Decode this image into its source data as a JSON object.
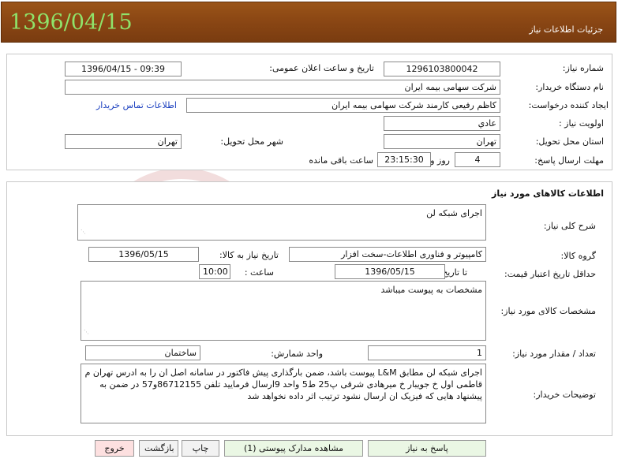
{
  "header": {
    "date": "1396/04/15",
    "title": "جزئیات اطلاعات نیاز"
  },
  "need": {
    "number_label": "شماره نیاز:",
    "number_value": "1296103800042",
    "announce_label": "تاریخ و ساعت اعلان عمومی:",
    "announce_value": "1396/04/15 - 09:39",
    "buyer_label": "نام دستگاه خریدار:",
    "buyer_value": "شرکت سهامی بیمه ایران",
    "creator_label": "ایجاد کننده درخواست:",
    "creator_value": "کاظم رفیعی کارمند شرکت سهامی بیمه ایران",
    "contact_link": "اطلاعات تماس خریدار",
    "priority_label": "اولویت نیاز :",
    "priority_value": "عادي",
    "province_label": "استان محل تحویل:",
    "province_value": "تهران",
    "city_label": "شهر محل تحویل:",
    "city_value": "تهران",
    "deadline_label": "مهلت ارسال پاسخ:",
    "deadline_days": "4",
    "days_label": "روز و",
    "deadline_time": "23:15:30",
    "remaining_label": "ساعت باقی مانده"
  },
  "goods": {
    "section_title": "اطلاعات کالاهای مورد نیاز",
    "desc_label": "شرح کلی نیاز:",
    "desc_value": "اجرای شبکه لن",
    "group_label": "گروه کالا:",
    "group_value": "کامپیوتر و فناوری اطلاعات-سخت افزار",
    "need_date_label": "تاریخ نیاز به کالا:",
    "need_date_value": "1396/05/15",
    "validity_label": "حداقل تاریخ اعتبار قیمت:",
    "to_date_label": "تا تاریخ :",
    "to_date_value": "1396/05/15",
    "time_label": "ساعت :",
    "time_value": "10:00",
    "spec_label": "مشخصات کالای مورد نیاز:",
    "spec_value": "مشخصات به پیوست میباشد",
    "qty_label": "تعداد / مقدار مورد نیاز:",
    "qty_value": "1",
    "unit_label": "واحد شمارش:",
    "unit_value": "ساختمان",
    "notes_label": "توضیحات خریدار:",
    "notes_value": "اجرای شبکه لن مطابق L&M پیوست باشد، ضمن بارگذاری پیش فاکتور در سامانه اصل ان را به ادرس تهران م قاطمی اول خ جویبار خ میرهادی شرقی پ25 ط5 واحد 9ارسال فرمایید تلفن 86712155و57 در ضمن به پیشنهاد هایی که فیزیک ان ارسال نشود ترتیب اثر داده نخواهد شد"
  },
  "buttons": {
    "reply": "پاسخ به نیاز",
    "attachments": "مشاهده مدارک پیوستی (1)",
    "print": "چاپ",
    "back": "بازگشت",
    "exit": "خروج"
  }
}
